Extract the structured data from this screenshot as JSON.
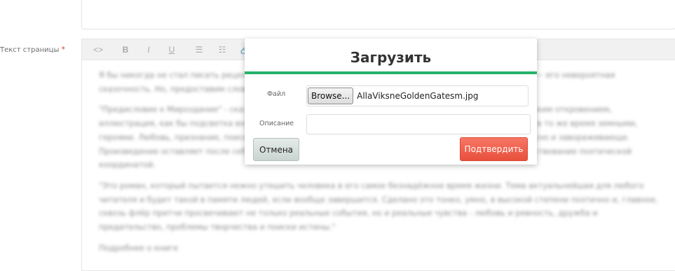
{
  "form": {
    "page_text_label": "Текст страницы",
    "required_mark": "*"
  },
  "editor": {
    "toolbar": {
      "code": "<>",
      "bold": "B",
      "italic": "I",
      "underline": "U",
      "bullet_list": "☰",
      "numbered_list": "☷",
      "link": "🔗"
    },
    "paragraphs": [
      "Я бы никогда не стал писать рецензию на этот роман, если бы не один момент, который меня поразил, — его невероятная сказочность. Но, предоставим слово первым читателям.",
      "\"Предисловие к Мироздание\" - сказочный роман, где всё стоит на грани между реальностью и поэтическим откровением, иллюстрация, как бы подсветка внутреннего мира героев, где каждая деталь оказывается значимой, и в то же время земными, героями. Любовь, признание, поиск себя — всё это проходит через призму мечты и реальности. Интересно и завораживающе. Произведение оставляет после себя ощущение чуда и трогательной наивности, опрокидывающее повествование поэтической координатой.",
      "\"Это роман, который пытается нежно утешить человека в его самое безнадёжное время жизни. Тема актуальнейшая для любого читателя и будет такой в памяти людей, если вообще завершится. Сделано это тонко, умно, в высокой степени поэтично и, главное, сквозь флёр притчи просвечивают не только реальные события, но и реальные чувства - любовь и ревность, дружба и предательство, проблемы творчества и поиски истины.\"",
      "Подробнее о книге"
    ]
  },
  "modal": {
    "title": "Загрузить",
    "file_label": "Файл",
    "browse_label": "Browse...",
    "file_name": "AllaViksneGoldenGatesm.jpg",
    "description_label": "Описание",
    "description_value": "",
    "cancel_label": "Отмена",
    "confirm_label": "Подтвердить"
  },
  "colors": {
    "accent_green": "#27b36b",
    "confirm_red": "#ef5f4b",
    "required_red": "#e53935"
  }
}
